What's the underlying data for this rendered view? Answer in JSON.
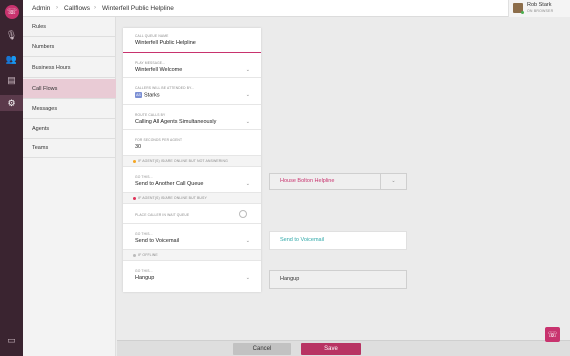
{
  "rail": {
    "icons": [
      "phone-icon",
      "microphone-icon",
      "users-icon",
      "contacts-icon",
      "settings-icon",
      "desktop-icon"
    ]
  },
  "breadcrumb": {
    "items": [
      "Admin",
      "Callflows",
      "Winterfell Public Helpline"
    ]
  },
  "user": {
    "name": "Rob Stark",
    "status": "ON BROWSER"
  },
  "menu": {
    "items": [
      "Rules",
      "Numbers",
      "Business Hours",
      "Call Flows",
      "Messages",
      "Agents",
      "Teams"
    ],
    "active": "Call Flows"
  },
  "form": {
    "queue_name_label": "CALL QUEUE NAME",
    "queue_name_value": "Winterfell Public Helpline",
    "play_message_label": "PLAY MESSAGE...",
    "play_message_value": "Winterfell Welcome",
    "attended_by_label": "CALLERS WILL BE ATTENDED BY...",
    "attended_by_badge": "AS",
    "attended_by_value": "Starks",
    "route_label": "ROUTE CALLS BY",
    "route_value": "Calling All Agents Simultaneously",
    "seconds_label": "FOR SECONDS PER AGENT",
    "seconds_value": "30",
    "section_not_answering": "IF AGENT(S) IS/ARE ONLINE BUT NOT ANSWERING",
    "goto1_label": "GO THIS...",
    "goto1_value": "Send to Another Call Queue",
    "section_busy": "IF AGENT(S) IS/ARE ONLINE BUT BUSY",
    "wait_queue_label": "PLACE CALLER IN WAIT QUEUE",
    "goto2_label": "GO THIS...",
    "goto2_value": "Send to Voicemail",
    "section_offline": "IF OFFLINE",
    "goto3_label": "GO THIS...",
    "goto3_value": "Hangup"
  },
  "targets": {
    "queue_target": "House Bolton Helpline",
    "voicemail_target": "Send to Voicemail",
    "hangup_target": "Hangup"
  },
  "footer": {
    "cancel_label": "Cancel",
    "save_label": "Save"
  },
  "colors": {
    "accent": "#c8336e",
    "rail_bg": "#3a2430",
    "teal_text": "#2fa8a8",
    "warning_dot": "#f5a623",
    "danger_dot": "#e0335a"
  }
}
